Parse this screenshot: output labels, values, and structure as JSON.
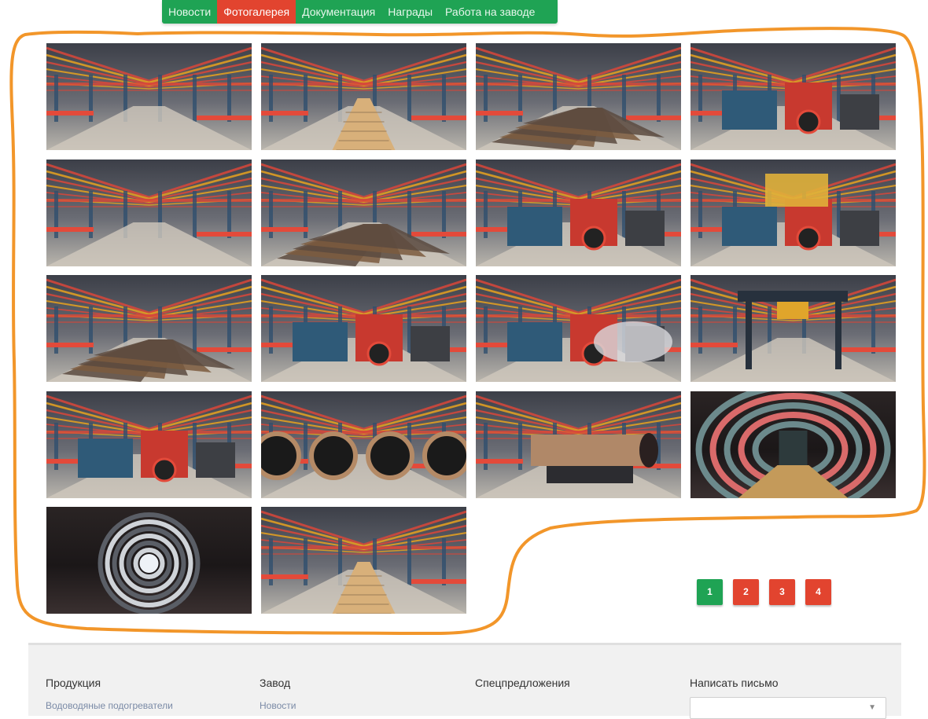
{
  "nav": {
    "items": [
      {
        "label": "Новости",
        "active": false
      },
      {
        "label": "Фотогалерея",
        "active": true
      },
      {
        "label": "Документация",
        "active": false
      },
      {
        "label": "Награды",
        "active": false
      },
      {
        "label": "Работа на заводе",
        "active": false
      }
    ]
  },
  "gallery": {
    "photos": [
      {
        "theme": "hall"
      },
      {
        "theme": "corridor"
      },
      {
        "theme": "plates"
      },
      {
        "theme": "machinery"
      },
      {
        "theme": "hall"
      },
      {
        "theme": "beams"
      },
      {
        "theme": "machinery"
      },
      {
        "theme": "press"
      },
      {
        "theme": "plates"
      },
      {
        "theme": "machinery"
      },
      {
        "theme": "steam"
      },
      {
        "theme": "gantry"
      },
      {
        "theme": "machinery"
      },
      {
        "theme": "pipes"
      },
      {
        "theme": "pipe"
      },
      {
        "theme": "tunnel"
      },
      {
        "theme": "rings"
      },
      {
        "theme": "corridor"
      }
    ]
  },
  "pagination": {
    "pages": [
      "1",
      "2",
      "3",
      "4"
    ],
    "current": "1"
  },
  "footer": {
    "columns": [
      {
        "title": "Продукция",
        "link": "Водоводяные подогреватели"
      },
      {
        "title": "Завод",
        "link": "Новости"
      },
      {
        "title": "Спецпредложения",
        "link": ""
      },
      {
        "title": "Написать письмо",
        "link": ""
      }
    ]
  },
  "colors": {
    "brand_green": "#1fa354",
    "brand_red": "#e2442f",
    "annotation_orange": "#f2962a"
  }
}
